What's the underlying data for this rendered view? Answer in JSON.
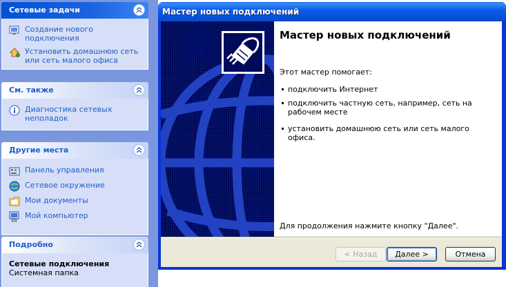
{
  "taskpane": {
    "network_tasks": {
      "title": "Сетевые задачи",
      "items": [
        {
          "label": "Создание нового подключения",
          "icon": "new-connection-icon"
        },
        {
          "label": "Установить домашнюю сеть или сеть малого офиса",
          "icon": "home-network-icon"
        }
      ]
    },
    "see_also": {
      "title": "См. также",
      "items": [
        {
          "label": "Диагностика сетевых неполадок",
          "icon": "info-icon"
        }
      ]
    },
    "other_places": {
      "title": "Другие места",
      "items": [
        {
          "label": "Панель управления",
          "icon": "control-panel-icon"
        },
        {
          "label": "Сетевое окружение",
          "icon": "network-places-icon"
        },
        {
          "label": "Мои документы",
          "icon": "my-documents-icon"
        },
        {
          "label": "Мой компьютер",
          "icon": "my-computer-icon"
        }
      ]
    },
    "details": {
      "title": "Подробно",
      "name": "Сетевые подключения",
      "type": "Системная папка"
    }
  },
  "wizard": {
    "window_title": "Мастер новых подключений",
    "heading": "Мастер новых подключений",
    "intro": "Этот мастер помогает:",
    "bullets": [
      "подключить Интернет",
      "подключить частную сеть, например, сеть на рабочем месте",
      "установить домашнюю сеть или сеть малого офиса."
    ],
    "continue_text": "Для продолжения нажмите кнопку \"Далее\".",
    "buttons": {
      "back": "< Назад",
      "next": "Далее >",
      "cancel": "Отмена"
    }
  },
  "colors": {
    "taskpane_bg": "#7a96df",
    "link": "#215dc6",
    "titlebar": "#0650d8",
    "banner": "#000a5a"
  }
}
